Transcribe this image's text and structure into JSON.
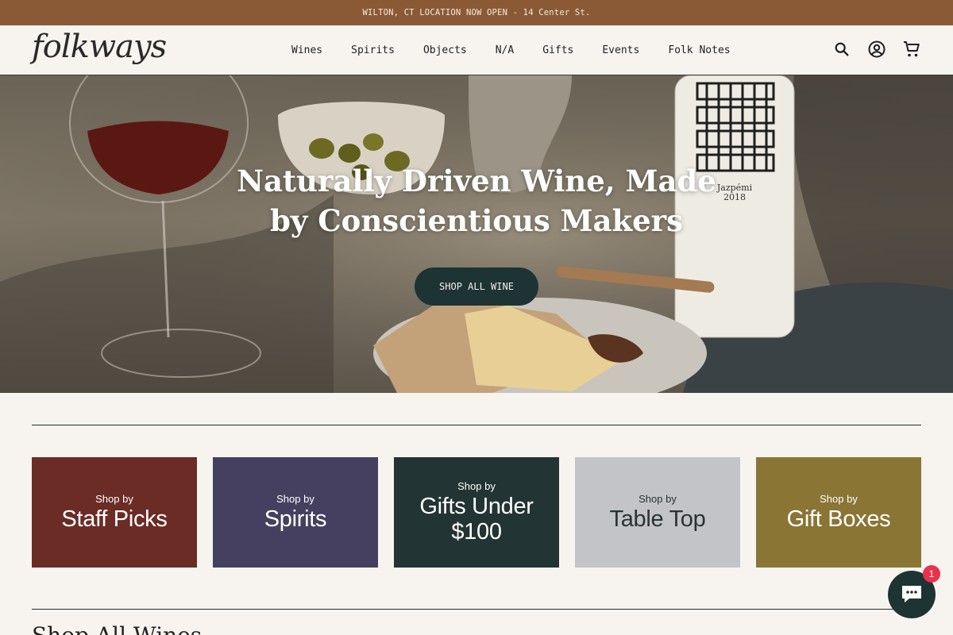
{
  "announcement": "WILTON, CT LOCATION NOW OPEN - 14 Center St.",
  "header": {
    "logo": "folkways",
    "nav": [
      "Wines",
      "Spirits",
      "Objects",
      "N/A",
      "Gifts",
      "Events",
      "Folk Notes"
    ],
    "icons": [
      "search-icon",
      "account-icon",
      "cart-icon"
    ]
  },
  "hero": {
    "title_line1": "Naturally Driven Wine, Made",
    "title_line2": "by Conscientious Makers",
    "bottle_label": "Jazpémi",
    "bottle_year": "2018",
    "button": "SHOP ALL WINE"
  },
  "tiles": [
    {
      "small": "Shop by",
      "big": "Staff Picks",
      "bg": "#6a2c25",
      "fg": "#ffffff"
    },
    {
      "small": "Shop by",
      "big": "Spirits",
      "bg": "#45405f",
      "fg": "#ffffff"
    },
    {
      "small": "Shop by",
      "big": "Gifts Under $100",
      "bg": "#223433",
      "fg": "#ffffff"
    },
    {
      "small": "Shop by",
      "big": "Table Top",
      "bg": "#c3c4c8",
      "fg": "#2a3233"
    },
    {
      "small": "Shop by",
      "big": "Gift Boxes",
      "bg": "#8a7535",
      "fg": "#ffffff"
    }
  ],
  "section_title": "Shop All Wines",
  "chat": {
    "badge": "1"
  },
  "colors": {
    "announcement_bg": "#8a5a37",
    "button_bg": "#1e3334",
    "page_bg": "#f7f4f0"
  }
}
